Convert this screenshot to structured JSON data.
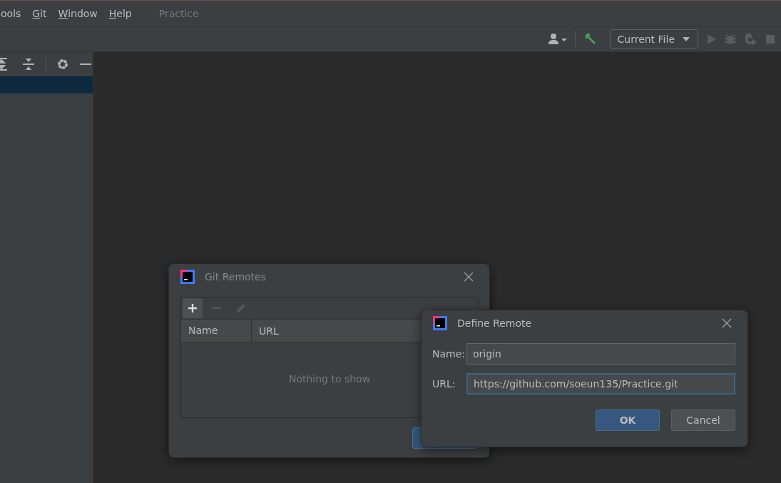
{
  "menu_bar": {
    "items": [
      "ools",
      "Git",
      "Window",
      "Help"
    ],
    "project_title": "Practice"
  },
  "toolbar": {
    "run_configuration": "Current File"
  },
  "project_panel": {
    "rows": [
      {
        "selected": true
      }
    ]
  },
  "git_remotes_dialog": {
    "title": "Git Remotes",
    "columns": [
      "Name",
      "URL"
    ],
    "empty_text": "Nothing to show"
  },
  "define_remote_dialog": {
    "title": "Define Remote",
    "fields": [
      {
        "label": "Name:",
        "value": "origin",
        "focused": false
      },
      {
        "label": "URL:",
        "value": "https://github.com/soeun135/Practice.git",
        "focused": true
      }
    ],
    "buttons": [
      {
        "label": "OK",
        "kind": "primary"
      },
      {
        "label": "Cancel",
        "kind": "secondary"
      }
    ]
  }
}
